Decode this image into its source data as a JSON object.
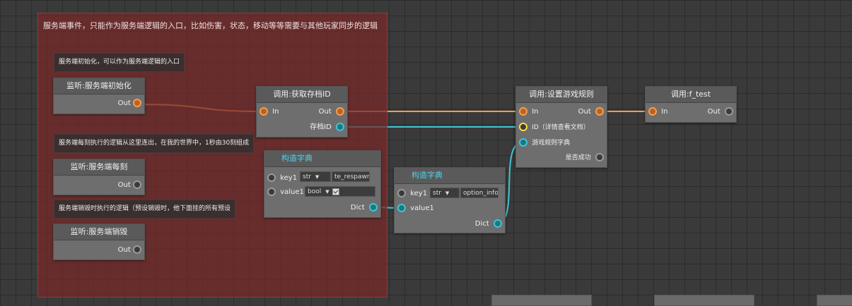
{
  "group": {
    "title": "服务端事件，只能作为服务端逻辑的入口，比如伤害，状态，移动等等需要与其他玩家同步的逻辑"
  },
  "comments": {
    "init": "服务端初始化，可以作为服务端逻辑的入口",
    "tick": "服务端每刻执行的逻辑从这里连出，在我的世界中，1秒由30刻组成",
    "destroy": "服务端销毁时执行的逻辑（预设销毁时，他下面挂的所有预设"
  },
  "nodes": {
    "listen_init": {
      "title": "监听:服务端初始化",
      "out": "Out"
    },
    "listen_tick": {
      "title": "监听:服务端每刻",
      "out": "Out"
    },
    "listen_destroy": {
      "title": "监听:服务端销毁",
      "out": "Out"
    },
    "get_save_id": {
      "title": "调用:获取存档ID",
      "in": "In",
      "out": "Out",
      "save_id": "存档ID"
    },
    "dict1": {
      "title": "构造字典",
      "key1": "key1",
      "key1_type": "str",
      "key1_value": "te_respawn",
      "value1": "value1",
      "value1_type": "bool",
      "dict": "Dict"
    },
    "dict2": {
      "title": "构造字典",
      "key1": "key1",
      "key1_type": "str",
      "key1_value": "option_info",
      "value1": "value1",
      "dict": "Dict"
    },
    "set_rules": {
      "title": "调用:设置游戏规则",
      "in": "In",
      "out": "Out",
      "id": "ID（详情查看文档）",
      "rules_dict": "游戏规则字典",
      "success": "是否成功"
    },
    "f_test": {
      "title": "调用:f_test",
      "in": "In",
      "out": "Out"
    }
  },
  "colors": {
    "exec_wire": "#f0a050",
    "data_wire": "#3fc4d4",
    "group_bg": "#782828"
  }
}
